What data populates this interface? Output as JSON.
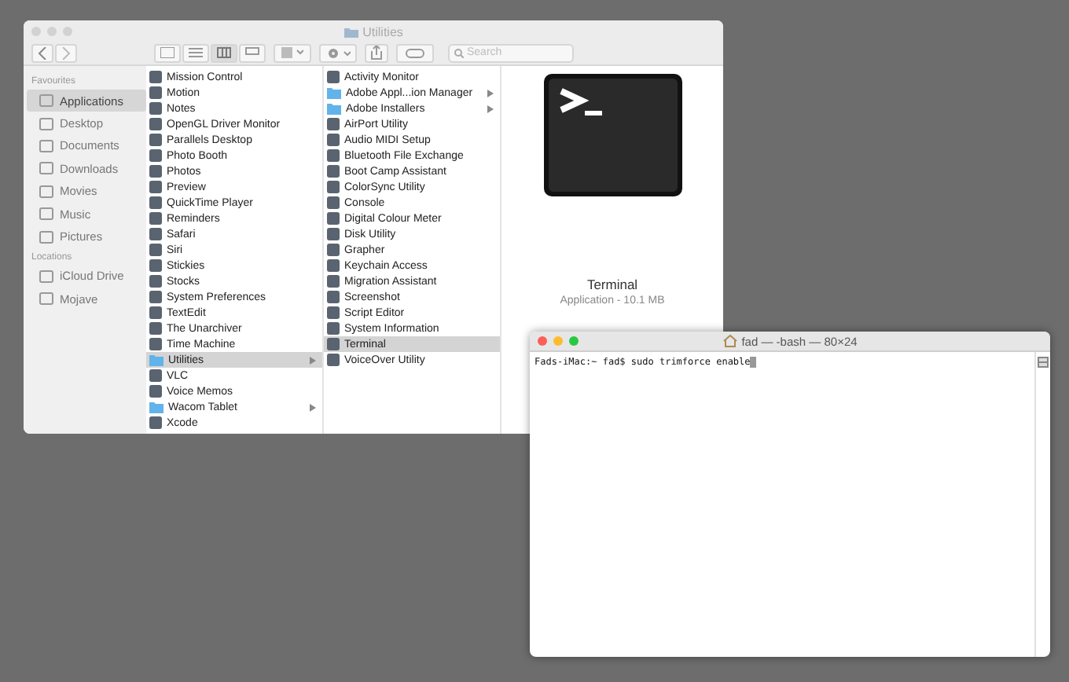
{
  "finder": {
    "title": "Utilities",
    "search": {
      "placeholder": "Search"
    },
    "sidebar": [
      {
        "heading": "Favourites",
        "items": [
          {
            "label": "Applications",
            "selected": true
          },
          {
            "label": "Desktop",
            "selected": false
          },
          {
            "label": "Documents",
            "selected": false
          },
          {
            "label": "Downloads",
            "selected": false
          },
          {
            "label": "Movies",
            "selected": false
          },
          {
            "label": "Music",
            "selected": false
          },
          {
            "label": "Pictures",
            "selected": false
          }
        ]
      },
      {
        "heading": "Locations",
        "items": [
          {
            "label": "iCloud Drive",
            "selected": false
          },
          {
            "label": "Mojave",
            "selected": false
          }
        ]
      }
    ],
    "columns": [
      {
        "items": [
          {
            "label": "Mission Control",
            "kind": "app",
            "selected": false
          },
          {
            "label": "Motion",
            "kind": "app",
            "selected": false
          },
          {
            "label": "Notes",
            "kind": "app",
            "selected": false
          },
          {
            "label": "OpenGL Driver Monitor",
            "kind": "app",
            "selected": false
          },
          {
            "label": "Parallels Desktop",
            "kind": "app",
            "selected": false
          },
          {
            "label": "Photo Booth",
            "kind": "app",
            "selected": false
          },
          {
            "label": "Photos",
            "kind": "app",
            "selected": false
          },
          {
            "label": "Preview",
            "kind": "app",
            "selected": false
          },
          {
            "label": "QuickTime Player",
            "kind": "app",
            "selected": false
          },
          {
            "label": "Reminders",
            "kind": "app",
            "selected": false
          },
          {
            "label": "Safari",
            "kind": "app",
            "selected": false
          },
          {
            "label": "Siri",
            "kind": "app",
            "selected": false
          },
          {
            "label": "Stickies",
            "kind": "app",
            "selected": false
          },
          {
            "label": "Stocks",
            "kind": "app",
            "selected": false
          },
          {
            "label": "System Preferences",
            "kind": "app",
            "selected": false
          },
          {
            "label": "TextEdit",
            "kind": "app",
            "selected": false
          },
          {
            "label": "The Unarchiver",
            "kind": "app",
            "selected": false
          },
          {
            "label": "Time Machine",
            "kind": "app",
            "selected": false
          },
          {
            "label": "Utilities",
            "kind": "folder",
            "selected": true
          },
          {
            "label": "VLC",
            "kind": "app",
            "selected": false
          },
          {
            "label": "Voice Memos",
            "kind": "app",
            "selected": false
          },
          {
            "label": "Wacom Tablet",
            "kind": "folder",
            "selected": false
          },
          {
            "label": "Xcode",
            "kind": "app",
            "selected": false
          }
        ]
      },
      {
        "items": [
          {
            "label": "Activity Monitor",
            "kind": "app",
            "selected": false
          },
          {
            "label": "Adobe Appl...ion Manager",
            "kind": "folder",
            "selected": false
          },
          {
            "label": "Adobe Installers",
            "kind": "folder",
            "selected": false
          },
          {
            "label": "AirPort Utility",
            "kind": "app",
            "selected": false
          },
          {
            "label": "Audio MIDI Setup",
            "kind": "app",
            "selected": false
          },
          {
            "label": "Bluetooth File Exchange",
            "kind": "app",
            "selected": false
          },
          {
            "label": "Boot Camp Assistant",
            "kind": "app",
            "selected": false
          },
          {
            "label": "ColorSync Utility",
            "kind": "app",
            "selected": false
          },
          {
            "label": "Console",
            "kind": "app",
            "selected": false
          },
          {
            "label": "Digital Colour Meter",
            "kind": "app",
            "selected": false
          },
          {
            "label": "Disk Utility",
            "kind": "app",
            "selected": false
          },
          {
            "label": "Grapher",
            "kind": "app",
            "selected": false
          },
          {
            "label": "Keychain Access",
            "kind": "app",
            "selected": false
          },
          {
            "label": "Migration Assistant",
            "kind": "app",
            "selected": false
          },
          {
            "label": "Screenshot",
            "kind": "app",
            "selected": false
          },
          {
            "label": "Script Editor",
            "kind": "app",
            "selected": false
          },
          {
            "label": "System Information",
            "kind": "app",
            "selected": false
          },
          {
            "label": "Terminal",
            "kind": "app",
            "selected": true
          },
          {
            "label": "VoiceOver Utility",
            "kind": "app",
            "selected": false
          }
        ]
      }
    ],
    "preview": {
      "name": "Terminal",
      "info": "Application - 10.1 MB"
    }
  },
  "terminal": {
    "title": "fad — -bash — 80×24",
    "lines": [
      "Fads-iMac:~ fad$ sudo trimforce enable"
    ]
  }
}
